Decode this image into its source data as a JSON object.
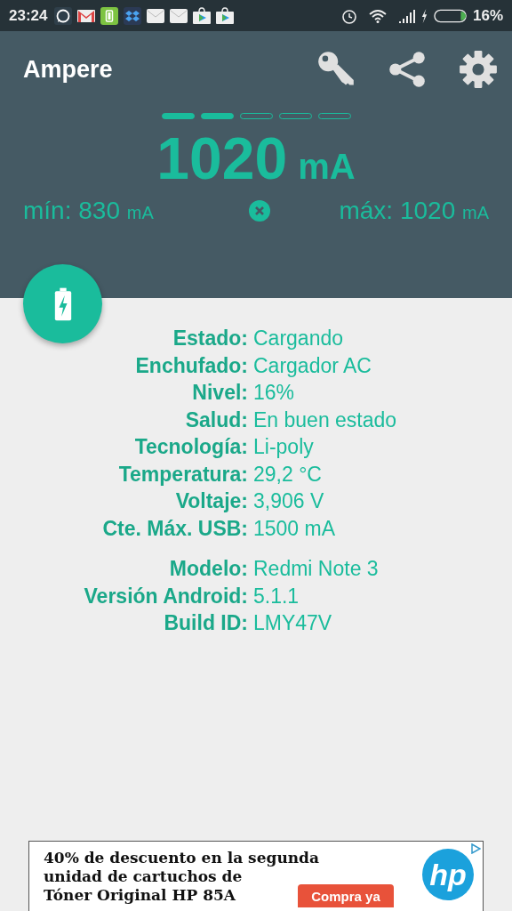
{
  "status_bar": {
    "time": "23:24",
    "notifications": [
      {
        "kind": "chat"
      },
      {
        "kind": "mail"
      },
      {
        "kind": "battery"
      },
      {
        "kind": "box"
      },
      {
        "kind": "envelope"
      },
      {
        "kind": "envelope"
      },
      {
        "kind": "store"
      },
      {
        "kind": "store"
      }
    ],
    "battery_text": "16%"
  },
  "app_bar": {
    "title": "Ampere",
    "actions": [
      {
        "kind": "key"
      },
      {
        "kind": "share"
      },
      {
        "kind": "settings"
      }
    ]
  },
  "pages": [
    {
      "filled": true
    },
    {
      "filled": true
    },
    {
      "filled": false
    },
    {
      "filled": false
    },
    {
      "filled": false
    }
  ],
  "current": {
    "value": "1020",
    "unit": "mA"
  },
  "min": {
    "label": "mín:",
    "value": "830",
    "unit": "mA"
  },
  "max": {
    "label": "máx:",
    "value": "1020",
    "unit": "mA"
  },
  "battery_info": [
    {
      "label": "Estado:",
      "value": "Cargando"
    },
    {
      "label": "Enchufado:",
      "value": "Cargador AC"
    },
    {
      "label": "Nivel:",
      "value": "16%"
    },
    {
      "label": "Salud:",
      "value": "En buen estado"
    },
    {
      "label": "Tecnología:",
      "value": "Li-poly"
    },
    {
      "label": "Temperatura:",
      "value": "29,2 °C"
    },
    {
      "label": "Voltaje:",
      "value": "3,906 V"
    },
    {
      "label": "Cte. Máx. USB:",
      "value": "1500 mA"
    }
  ],
  "device_info": [
    {
      "label": "Modelo:",
      "value": "Redmi Note 3"
    },
    {
      "label": "Versión Android:",
      "value": "5.1.1"
    },
    {
      "label": "Build ID:",
      "value": "LMY47V"
    }
  ],
  "ad": {
    "lines": [
      "**40% de descuento** en la segunda",
      "unidad de cartuchos de",
      "**Tóner Original HP 85A**"
    ],
    "button": "Compra ya",
    "logo": "hp"
  }
}
